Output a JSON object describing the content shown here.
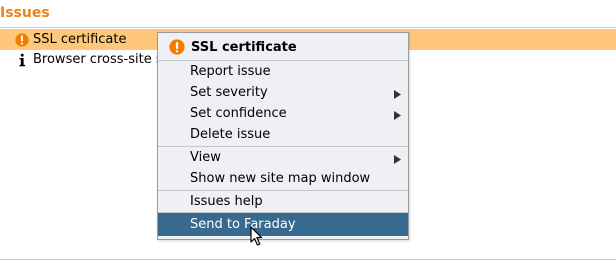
{
  "panel": {
    "title": "Issues"
  },
  "issues": [
    {
      "label": "SSL certificate",
      "icon": "warning-circle-icon",
      "selected": true
    },
    {
      "label": "Browser cross-site scripting filter disabled",
      "icon": "info-icon",
      "selected": false
    }
  ],
  "context_menu": {
    "header": "SSL certificate",
    "items": [
      {
        "label": "Report issue"
      },
      {
        "label": "Set severity",
        "submenu": true
      },
      {
        "label": "Set confidence",
        "submenu": true
      },
      {
        "label": "Delete issue"
      },
      {
        "label": "View",
        "submenu": true
      },
      {
        "label": "Show new site map window"
      },
      {
        "label": "Issues help"
      },
      {
        "label": "Send to Faraday",
        "highlighted": true
      }
    ]
  },
  "colors": {
    "accent": "#e8821c",
    "selected_row": "#ffc77a",
    "menu_highlight": "#376a8e",
    "warning_icon": "#f07d00"
  }
}
